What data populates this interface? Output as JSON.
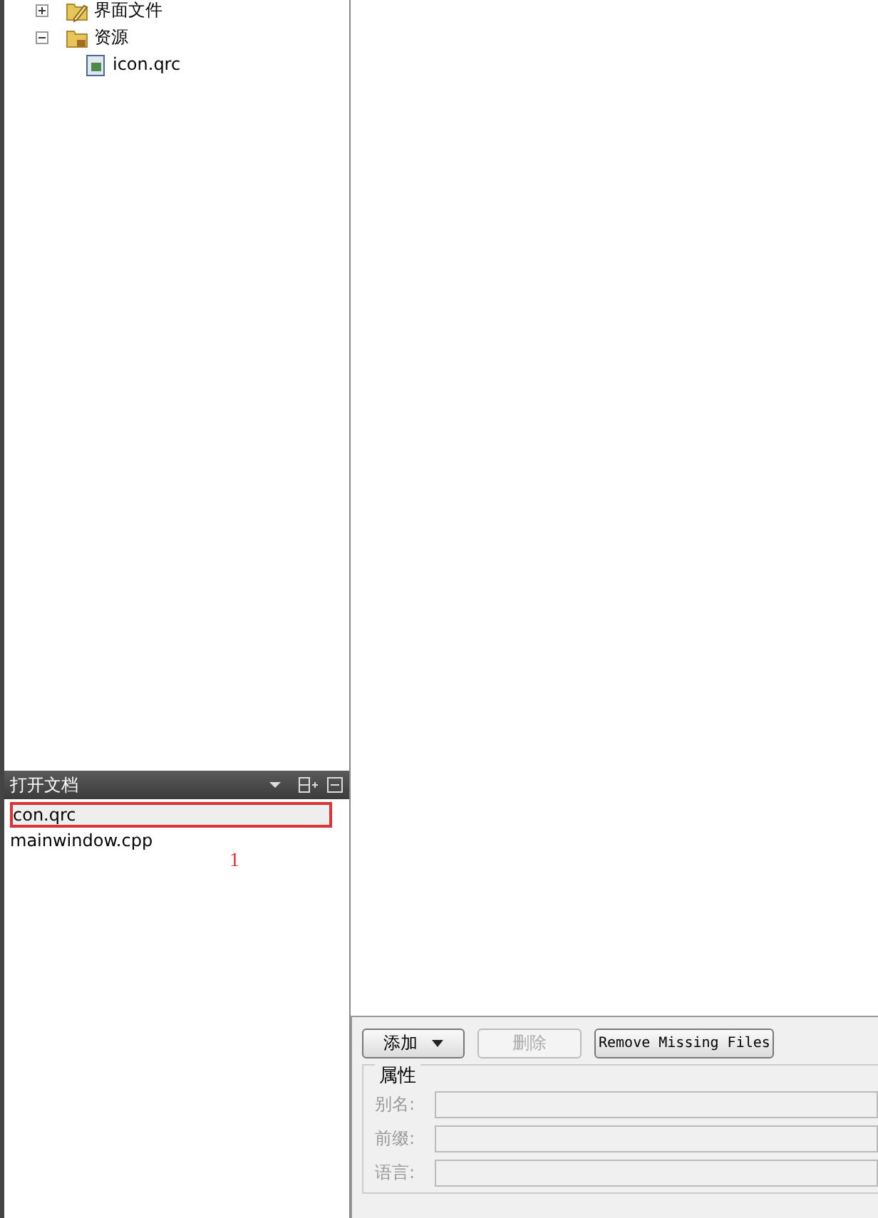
{
  "project_tree": [
    {
      "label": "界面文件",
      "kind": "folder-ui",
      "expanded": false
    },
    {
      "label": "资源",
      "kind": "folder-res",
      "expanded": true,
      "children": [
        {
          "label": "icon.qrc",
          "kind": "file"
        }
      ]
    }
  ],
  "open_documents": {
    "title": "打开文档",
    "annotation": "1",
    "items": [
      {
        "label": "con.qrc",
        "selected": true
      },
      {
        "label": "mainwindow.cpp",
        "selected": false
      }
    ]
  },
  "resource_editor": {
    "buttons": [
      {
        "label": "添加",
        "kind": "dropdown",
        "disabled": false
      },
      {
        "label": "删除",
        "kind": "plain",
        "disabled": true
      },
      {
        "label": "Remove Missing Files",
        "kind": "mono",
        "disabled": false
      }
    ],
    "group_title": "属性",
    "fields": [
      {
        "label": "别名:",
        "disabled": true
      },
      {
        "label": "前缀:",
        "disabled": true
      },
      {
        "label": "语言:",
        "disabled": true
      }
    ]
  }
}
